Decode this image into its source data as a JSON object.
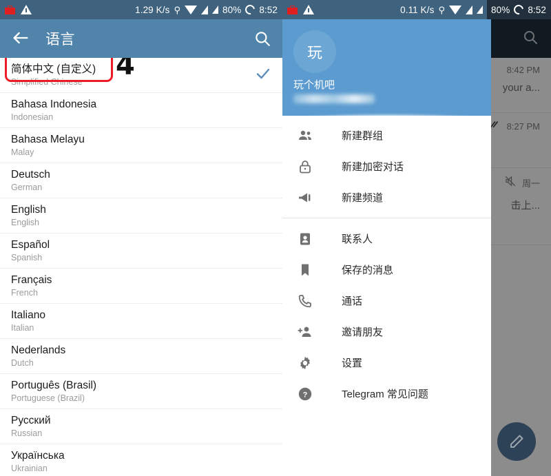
{
  "left_panel": {
    "statusbar": {
      "icons": [
        "briefcase-icon",
        "warning-icon",
        "key-icon",
        "wifi-icon",
        "signal-icon",
        "signal-icon-2",
        "battery-icon"
      ],
      "network_speed": "1.29 K/s",
      "battery": "80%",
      "clock": "8:52"
    },
    "toolbar": {
      "back_icon": "back-arrow-icon",
      "title": "语言",
      "search_icon": "search-icon"
    },
    "annotation": {
      "marker": "4",
      "box_color": "#ed1c24"
    },
    "languages": [
      {
        "native": "简体中文 (自定义)",
        "english": "Simplified Chinese",
        "selected": true
      },
      {
        "native": "Bahasa Indonesia",
        "english": "Indonesian",
        "selected": false
      },
      {
        "native": "Bahasa Melayu",
        "english": "Malay",
        "selected": false
      },
      {
        "native": "Deutsch",
        "english": "German",
        "selected": false
      },
      {
        "native": "English",
        "english": "English",
        "selected": false
      },
      {
        "native": "Español",
        "english": "Spanish",
        "selected": false
      },
      {
        "native": "Français",
        "english": "French",
        "selected": false
      },
      {
        "native": "Italiano",
        "english": "Italian",
        "selected": false
      },
      {
        "native": "Nederlands",
        "english": "Dutch",
        "selected": false
      },
      {
        "native": "Português (Brasil)",
        "english": "Portuguese (Brazil)",
        "selected": false
      },
      {
        "native": "Русский",
        "english": "Russian",
        "selected": false
      },
      {
        "native": "Українська",
        "english": "Ukrainian",
        "selected": false
      }
    ]
  },
  "right_panel": {
    "statusbar": {
      "network_speed": "0.11 K/s",
      "battery": "80%",
      "clock": "8:52"
    },
    "background": {
      "search_icon": "search-icon",
      "chats": [
        {
          "time": "8:42 PM",
          "snippet": "your a...",
          "read_icon": "",
          "mute_icon": ""
        },
        {
          "time": "8:27 PM",
          "snippet": "",
          "read_icon": "double-check-icon",
          "mute_icon": ""
        },
        {
          "time": "周一",
          "snippet": "击上...",
          "read_icon": "",
          "mute_icon": "mute-icon"
        }
      ],
      "fab_icon": "pencil-icon"
    },
    "drawer": {
      "avatar_initial": "玩",
      "account_name": "玩个机吧",
      "phone_redacted": "",
      "menu_groups": [
        [
          {
            "icon": "group-icon",
            "label": "新建群组"
          },
          {
            "icon": "lock-icon",
            "label": "新建加密对话"
          },
          {
            "icon": "megaphone-icon",
            "label": "新建频道"
          }
        ],
        [
          {
            "icon": "contacts-icon",
            "label": "联系人"
          },
          {
            "icon": "bookmark-icon",
            "label": "保存的消息"
          },
          {
            "icon": "phone-icon",
            "label": "通话"
          },
          {
            "icon": "person-add-icon",
            "label": "邀请朋友"
          },
          {
            "icon": "gear-icon",
            "label": "设置"
          },
          {
            "icon": "help-icon",
            "label": "Telegram 常见问题"
          }
        ]
      ]
    }
  },
  "colors": {
    "statusbar": "#3f637f",
    "toolbar": "#5084ab",
    "drawer_header": "#5b9bd0",
    "accent_check": "#5b8db8",
    "annotation_red": "#ed1c24"
  }
}
